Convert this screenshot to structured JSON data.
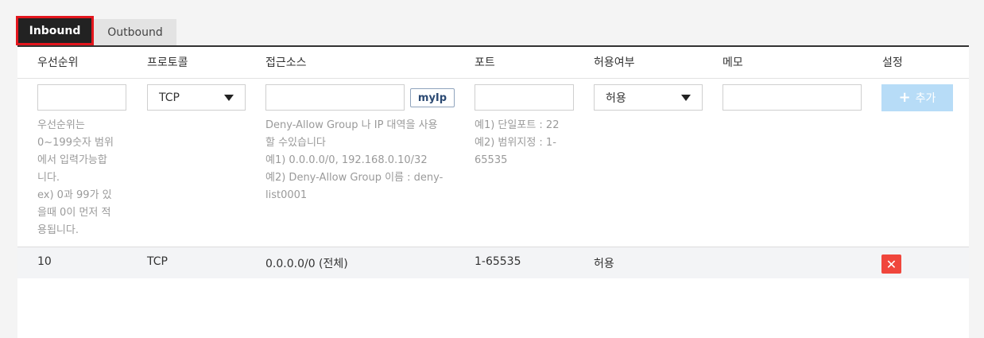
{
  "tabs": [
    {
      "label": "Inbound",
      "active": true
    },
    {
      "label": "Outbound",
      "active": false
    }
  ],
  "columns": {
    "priority": "우선순위",
    "protocol": "프로토콜",
    "source": "접근소스",
    "port": "포트",
    "allow": "허용여부",
    "memo": "메모",
    "settings": "설정"
  },
  "form": {
    "priority_value": "",
    "protocol_selected": "TCP",
    "source_value": "",
    "myip_label": "myIp",
    "port_value": "",
    "allow_selected": "허용",
    "memo_value": "",
    "add_label": "추가",
    "hints": {
      "priority": [
        "우선순위는",
        "0~199숫자 범위",
        "에서 입력가능합",
        "니다.",
        "ex) 0과 99가 있",
        "을때 0이 먼저 적",
        "용됩니다."
      ],
      "source": [
        "Deny-Allow Group 나 IP 대역을 사용",
        "할 수있습니다",
        "예1) 0.0.0.0/0, 192.168.0.10/32",
        "예2) Deny-Allow Group 이름 : deny-",
        "list0001"
      ],
      "port": [
        "예1) 단일포트 : 22",
        "예2) 범위지정 : 1-",
        "65535"
      ]
    }
  },
  "rows": [
    {
      "priority": "10",
      "protocol": "TCP",
      "source": "0.0.0.0/0 (전체)",
      "port": "1-65535",
      "allow": "허용",
      "memo": ""
    }
  ],
  "colors": {
    "active_tab_bg": "#222222",
    "active_tab_border": "#e3161d",
    "add_button_bg": "#b7dcf7",
    "delete_button_bg": "#f0463c"
  },
  "icons": {
    "add": "plus-icon",
    "delete": "close-icon",
    "dropdown": "caret-down-icon"
  }
}
